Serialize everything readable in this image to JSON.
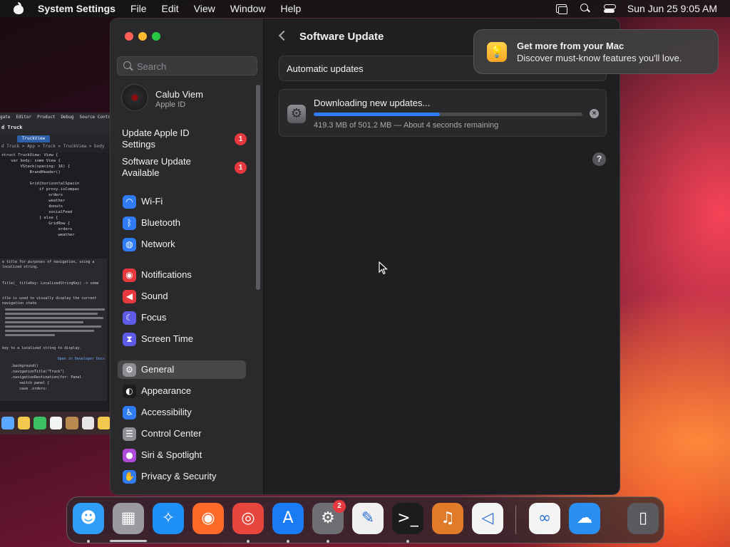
{
  "menubar": {
    "app_name": "System Settings",
    "items": [
      "File",
      "Edit",
      "View",
      "Window",
      "Help"
    ],
    "clock": "Sun Jun 25  9:05 AM"
  },
  "editor": {
    "menu": [
      "gate",
      "Editor",
      "Product",
      "Debug",
      "Source Contr"
    ],
    "title": "d Truck",
    "tab": "TruckView",
    "crumb": "d Truck > App > Truck > TruckView > body",
    "code": [
      "struct TruckView: View {",
      "    var body: some View {",
      "        VStack(spacing: 16) {",
      "            BrandHeader()",
      "",
      "            Grid(horizontalSpacin",
      "                if proxy.isCompac",
      "                    orders",
      "                    weather",
      "                    donuts",
      "                    socialFeed",
      "                } else {",
      "                    GridRow {",
      "                        orders",
      "                        weather"
    ],
    "doc_1": "e title for purposes of navigation, using a localized string.",
    "signature": "Title(_ titleKey: LocalizedStringKey) -> some",
    "doc_2": "itle is used to visually display the current navigation state",
    "doc_3": "key to a localized string to display.",
    "doc_link": "Open in Developer Docs",
    "code_2": [
      "    .background()",
      "    .navigationTitle(\"Truck\")",
      "    .navigationDestination(for: Panel",
      "        switch panel {",
      "        case .orders:"
    ]
  },
  "window": {
    "search_placeholder": "Search",
    "profile": {
      "name": "Calub Viem",
      "subtitle": "Apple ID"
    },
    "alerts": [
      {
        "label": "Update Apple ID Settings",
        "badge": "1"
      },
      {
        "label": "Software Update Available",
        "badge": "1"
      }
    ],
    "nav": [
      {
        "label": "Wi-Fi",
        "icon": "wifi-icon",
        "color": "#2f7cf6",
        "glyph": "◠"
      },
      {
        "label": "Bluetooth",
        "icon": "bluetooth-icon",
        "color": "#2f7cf6",
        "glyph": "ᛒ"
      },
      {
        "label": "Network",
        "icon": "globe-icon",
        "color": "#2f7cf6",
        "glyph": "◍"
      },
      {
        "label": "Notifications",
        "icon": "bell-icon",
        "color": "#e5393e",
        "glyph": "◉"
      },
      {
        "label": "Sound",
        "icon": "speaker-icon",
        "color": "#e5393e",
        "glyph": "◀"
      },
      {
        "label": "Focus",
        "icon": "moon-icon",
        "color": "#5e5ce6",
        "glyph": "☾"
      },
      {
        "label": "Screen Time",
        "icon": "hourglass-icon",
        "color": "#5e5ce6",
        "glyph": "⧗"
      },
      {
        "label": "General",
        "icon": "gear-icon",
        "color": "#8e8e93",
        "glyph": "⚙",
        "selected": true
      },
      {
        "label": "Appearance",
        "icon": "appearance-icon",
        "color": "#1c1c1e",
        "glyph": "◐"
      },
      {
        "label": "Accessibility",
        "icon": "accessibility-icon",
        "color": "#2f7cf6",
        "glyph": "♿"
      },
      {
        "label": "Control Center",
        "icon": "control-center-icon",
        "color": "#8e8e93",
        "glyph": "☰"
      },
      {
        "label": "Siri & Spotlight",
        "icon": "siri-icon",
        "color": "#b04ad8",
        "glyph": "●"
      },
      {
        "label": "Privacy & Security",
        "icon": "hand-icon",
        "color": "#2f7cf6",
        "glyph": "✋"
      }
    ],
    "main": {
      "title": "Software Update",
      "automatic_updates": "Automatic updates",
      "download_title": "Downloading new updates...",
      "download_status": "419.3 MB of 501.2 MB — About 4 seconds remaining",
      "progress": 0.47
    }
  },
  "notification": {
    "title": "Get more from your Mac",
    "body": "Discover must-know features you'll love."
  },
  "dock": {
    "apps": [
      {
        "name": "finder-icon",
        "color": "#2f9df7",
        "glyph": "☻",
        "running": true
      },
      {
        "name": "launchpad-icon",
        "color": "#9a9aa0",
        "glyph": "▦",
        "running": false
      },
      {
        "name": "safari-icon",
        "color": "#1e8ff5",
        "glyph": "✧",
        "running": false
      },
      {
        "name": "firefox-icon",
        "color": "#ff6a2a",
        "glyph": "◉",
        "running": false
      },
      {
        "name": "chrome-icon",
        "color": "#e8453c",
        "glyph": "◎",
        "running": true
      },
      {
        "name": "app-store-icon",
        "color": "#1a7cf5",
        "glyph": "A",
        "running": true
      },
      {
        "name": "system-settings-icon",
        "color": "#6e6e73",
        "glyph": "⚙",
        "running": true
      },
      {
        "name": "textedit-icon",
        "color": "#f0f0f0",
        "glyph": "✎",
        "running": false
      },
      {
        "name": "terminal-icon",
        "color": "#1c1c1e",
        "glyph": ">_",
        "running": true
      },
      {
        "name": "garageband-icon",
        "color": "#e07b2a",
        "glyph": "♫",
        "running": false
      },
      {
        "name": "vscode-icon",
        "color": "#f4f4f4",
        "glyph": "◁",
        "running": false
      },
      {
        "name": "visual-studio-icon",
        "color": "#f4f4f4",
        "glyph": "∞",
        "running": false
      },
      {
        "name": "weather-icon",
        "color": "#2a8ff0",
        "glyph": "☁",
        "running": false
      },
      {
        "name": "trash-icon",
        "color": "#5a5a5e",
        "glyph": "▯",
        "running": false
      }
    ],
    "settings_badge": "2"
  }
}
